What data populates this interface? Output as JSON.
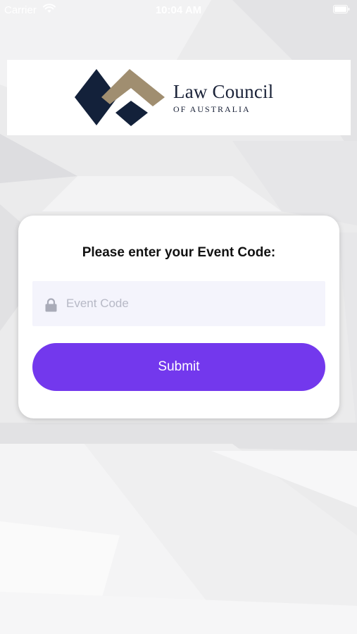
{
  "status_bar": {
    "carrier": "Carrier",
    "time": "10:04 AM",
    "wifi_icon": "wifi-icon",
    "battery_icon": "battery-icon"
  },
  "logo": {
    "title": "Law Council",
    "subtitle": "OF AUSTRALIA",
    "colors": {
      "navy": "#13213a",
      "gold": "#a08e70"
    }
  },
  "form": {
    "heading": "Please enter your Event Code:",
    "event_code": {
      "value": "",
      "placeholder": "Event Code",
      "icon": "lock-icon"
    },
    "submit_label": "Submit"
  },
  "colors": {
    "accent": "#7338ed",
    "field_background": "#f4f4fc",
    "card_background": "#ffffff"
  }
}
